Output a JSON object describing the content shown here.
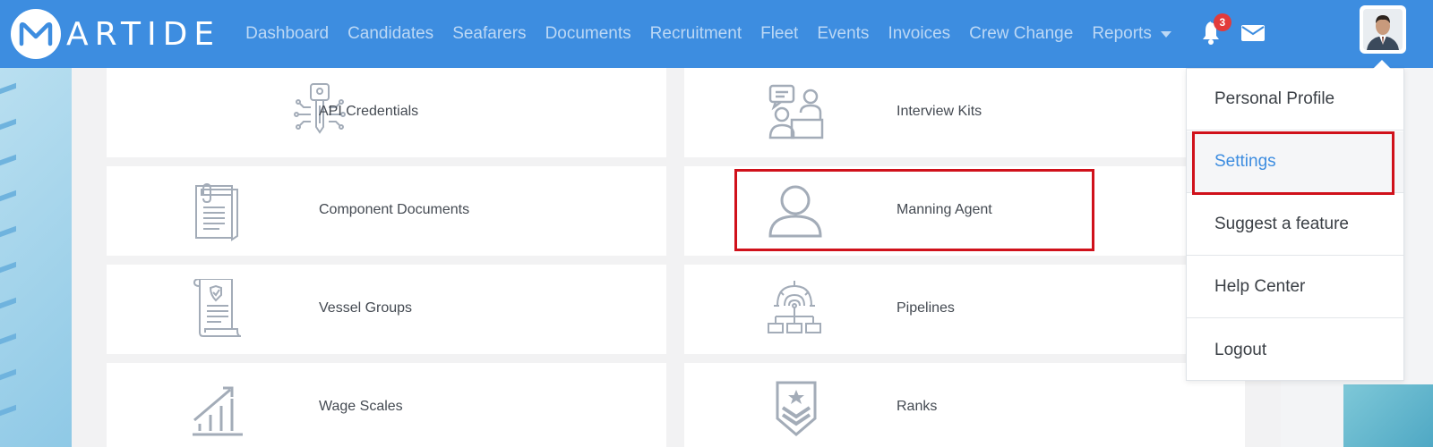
{
  "app": {
    "logo_text": "ARTIDE",
    "brand_color": "#3d8de0"
  },
  "nav": {
    "links": [
      "Dashboard",
      "Candidates",
      "Seafarers",
      "Documents",
      "Recruitment",
      "Fleet",
      "Events",
      "Invoices",
      "Crew Change",
      "Reports"
    ],
    "notification_count": "3"
  },
  "settings_cards": [
    {
      "label": "API Credentials",
      "icon": "api-key-icon"
    },
    {
      "label": "Interview Kits",
      "icon": "interview-icon"
    },
    {
      "label": "Component Documents",
      "icon": "documents-icon"
    },
    {
      "label": "Manning Agent",
      "icon": "user-icon"
    },
    {
      "label": "Vessel Groups",
      "icon": "certificate-icon"
    },
    {
      "label": "Pipelines",
      "icon": "pipeline-icon"
    },
    {
      "label": "Wage Scales",
      "icon": "chart-growth-icon"
    },
    {
      "label": "Ranks",
      "icon": "rank-chevron-icon"
    }
  ],
  "profile_menu": {
    "items": [
      "Personal Profile",
      "Settings",
      "Suggest a feature",
      "Help Center",
      "Logout"
    ],
    "active": "Settings"
  },
  "colors": {
    "highlight": "#d0111b",
    "icon_gray": "#a3acb8"
  }
}
